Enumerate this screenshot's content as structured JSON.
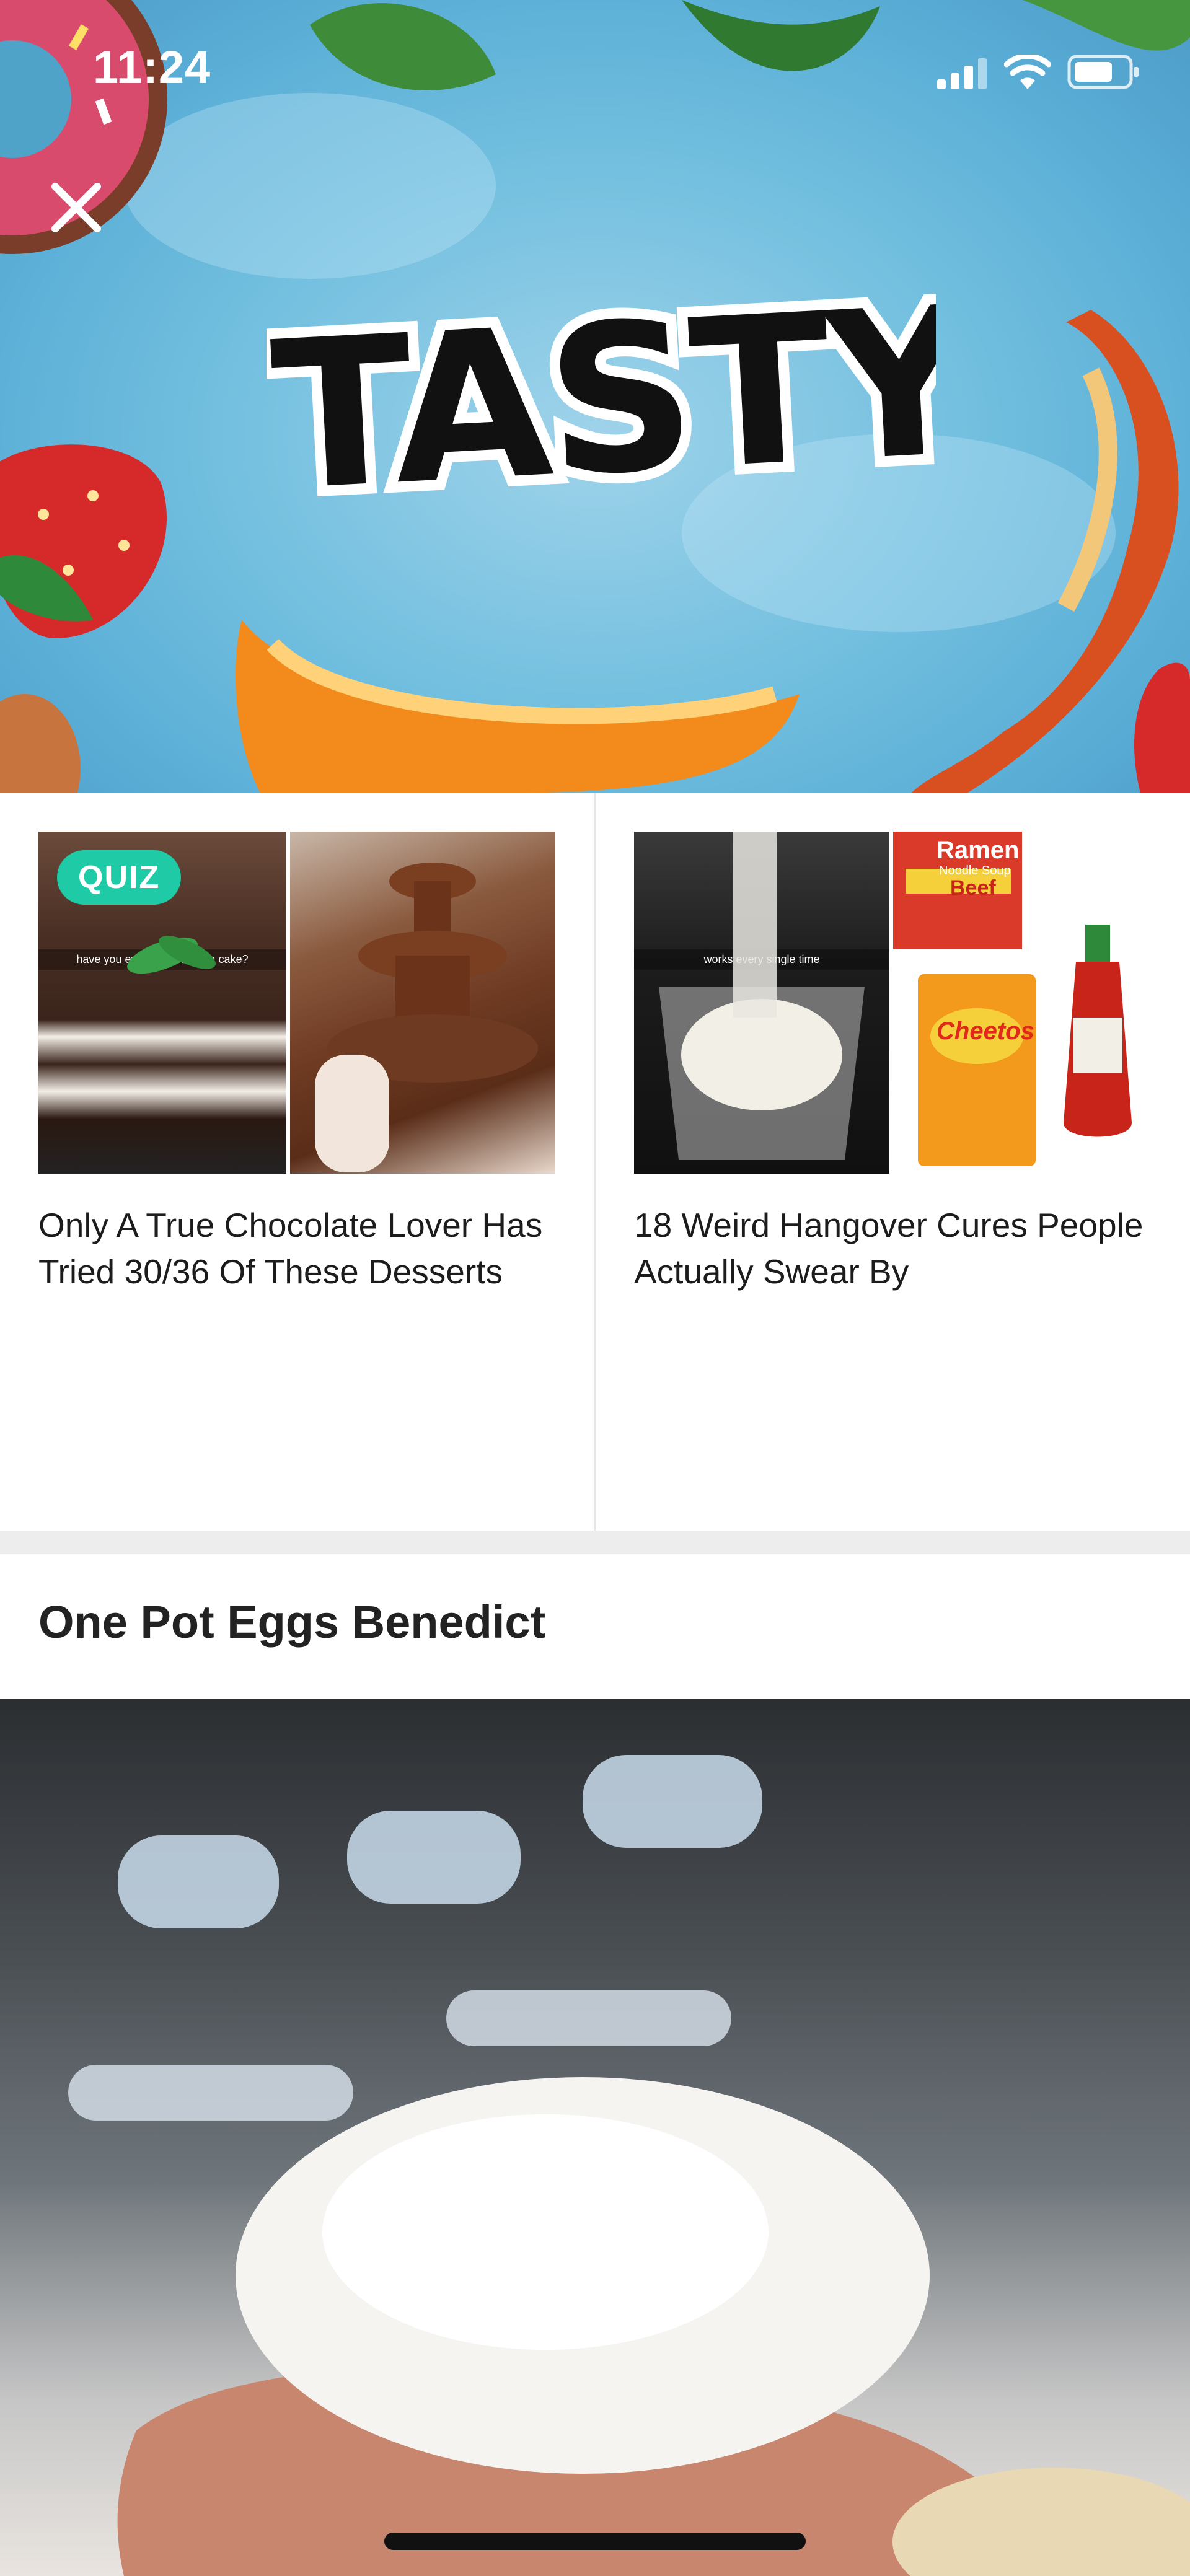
{
  "status_bar": {
    "time": "11:24",
    "icons": [
      "signal-icon",
      "wifi-icon",
      "battery-icon"
    ]
  },
  "header": {
    "close_icon": "close-icon",
    "logo_text": "TASTY"
  },
  "articles": [
    {
      "badge": "QUIZ",
      "image_caption": "have you ever had an opera cake?",
      "title": "Only A True Chocolate Lover Has Tried 30/36 Of These Desserts"
    },
    {
      "image_caption": "works every single time",
      "package_labels": [
        "Ramen",
        "Noodle Soup",
        "Beef",
        "Cheetos"
      ],
      "title": "18 Weird Hangover Cures People Actually Swear By"
    }
  ],
  "recipe": {
    "title": "One Pot Eggs Benedict"
  },
  "colors": {
    "quiz_badge": "#1fcba7",
    "hero_sky": "#72bfdf",
    "title_text": "#1c1c1c"
  }
}
